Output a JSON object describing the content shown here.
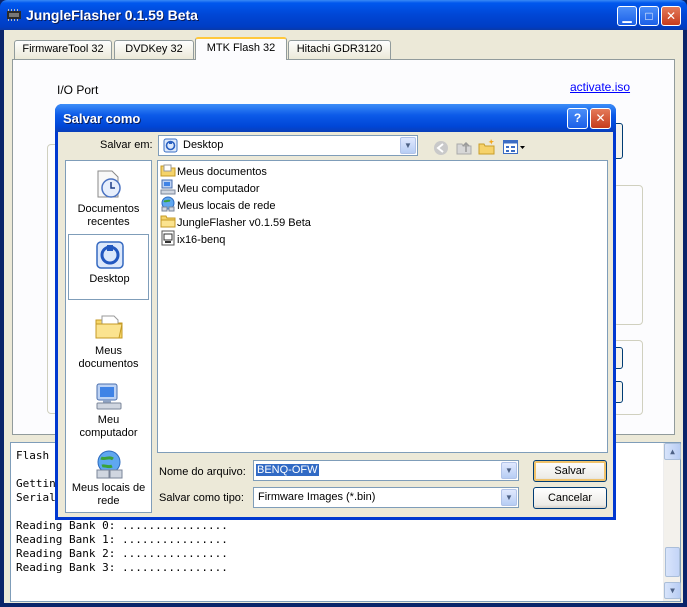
{
  "app": {
    "title": "JungleFlasher 0.1.59 Beta"
  },
  "tabs": [
    {
      "label": "FirmwareTool 32"
    },
    {
      "label": "DVDKey 32"
    },
    {
      "label": "MTK Flash 32"
    },
    {
      "label": "Hitachi GDR3120"
    }
  ],
  "active_tab": "MTK Flash 32",
  "panel": {
    "io_port_label": "I/O Port",
    "activate_link": "activate.iso"
  },
  "log": {
    "lines": [
      "Flash",
      "",
      "Gettin",
      "Serial",
      "",
      "Reading Bank 0: ................",
      "Reading Bank 1: ................",
      "Reading Bank 2: ................",
      "Reading Bank 3: ................"
    ]
  },
  "dialog": {
    "title": "Salvar como",
    "save_in_label": "Salvar em:",
    "save_in_value": "Desktop",
    "places": [
      {
        "label": "Documentos recentes",
        "icon": "recent-documents-icon"
      },
      {
        "label": "Desktop",
        "icon": "desktop-icon"
      },
      {
        "label": "Meus documentos",
        "icon": "my-documents-icon"
      },
      {
        "label": "Meu computador",
        "icon": "my-computer-icon"
      },
      {
        "label": "Meus locais de rede",
        "icon": "network-places-icon"
      }
    ],
    "files": [
      {
        "name": "Meus documentos",
        "icon": "folder-documents-icon"
      },
      {
        "name": "Meu computador",
        "icon": "computer-icon"
      },
      {
        "name": "Meus locais de rede",
        "icon": "network-icon"
      },
      {
        "name": "JungleFlasher v0.1.59 Beta",
        "icon": "folder-icon"
      },
      {
        "name": "ix16-benq",
        "icon": "file-icon"
      }
    ],
    "filename_label": "Nome do arquivo:",
    "filename_value": "BENQ-OFW",
    "filetype_label": "Salvar como tipo:",
    "filetype_value": "Firmware Images (*.bin)",
    "save_button": "Salvar",
    "cancel_button": "Cancelar"
  },
  "colors": {
    "titlebar": "#0046d5",
    "window_bg": "#ece9d8",
    "link": "#0000ff",
    "selection": "#316ac5"
  }
}
